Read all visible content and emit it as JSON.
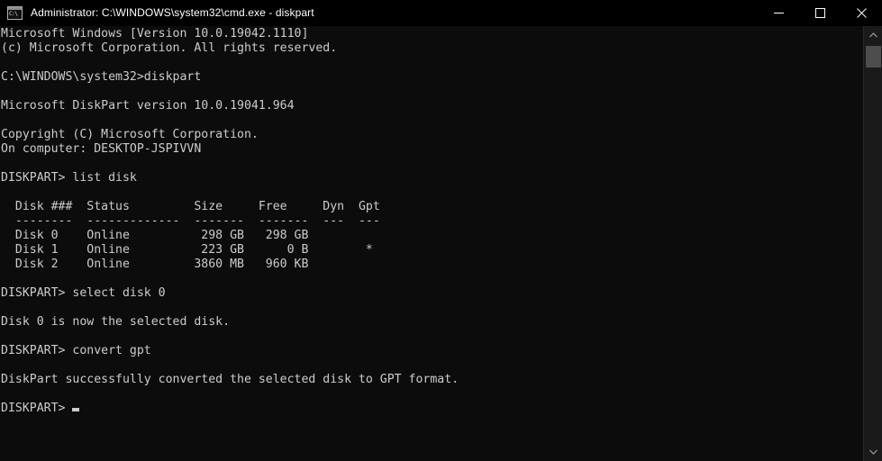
{
  "window": {
    "title": "Administrator: C:\\WINDOWS\\system32\\cmd.exe - diskpart",
    "icon_label": "C:\\",
    "icon_name": "cmd-console-icon",
    "background_color": "#0c0c0c",
    "titlebar_color": "#000000",
    "text_color": "#cccccc",
    "controls": {
      "minimize": "Minimize",
      "maximize": "Maximize",
      "close": "Close"
    }
  },
  "console": {
    "lines": [
      "Microsoft Windows [Version 10.0.19042.1110]",
      "(c) Microsoft Corporation. All rights reserved.",
      "",
      "C:\\WINDOWS\\system32>diskpart",
      "",
      "Microsoft DiskPart version 10.0.19041.964",
      "",
      "Copyright (C) Microsoft Corporation.",
      "On computer: DESKTOP-JSPIVVN",
      "",
      "DISKPART> list disk",
      "",
      "  Disk ###  Status         Size     Free     Dyn  Gpt",
      "  --------  -------------  -------  -------  ---  ---",
      "  Disk 0    Online          298 GB   298 GB",
      "  Disk 1    Online          223 GB      0 B        *",
      "  Disk 2    Online         3860 MB   960 KB",
      "",
      "DISKPART> select disk 0",
      "",
      "Disk 0 is now the selected disk.",
      "",
      "DISKPART> convert gpt",
      "",
      "DiskPart successfully converted the selected disk to GPT format.",
      "",
      "DISKPART> "
    ],
    "prompt": "DISKPART> ",
    "cursor": "block-underscore",
    "disk_table": {
      "headers": [
        "Disk ###",
        "Status",
        "Size",
        "Free",
        "Dyn",
        "Gpt"
      ],
      "rows": [
        [
          "Disk 0",
          "Online",
          "298 GB",
          "298 GB",
          "",
          ""
        ],
        [
          "Disk 1",
          "Online",
          "223 GB",
          "0 B",
          "",
          "*"
        ],
        [
          "Disk 2",
          "Online",
          "3860 MB",
          "960 KB",
          "",
          ""
        ]
      ]
    },
    "commands": [
      "diskpart",
      "list disk",
      "select disk 0",
      "convert gpt"
    ],
    "messages": [
      "Disk 0 is now the selected disk.",
      "DiskPart successfully converted the selected disk to GPT format."
    ]
  },
  "scrollbar": {
    "up_arrow": "scroll-up",
    "down_arrow": "scroll-down",
    "thumb": "scroll-thumb"
  }
}
